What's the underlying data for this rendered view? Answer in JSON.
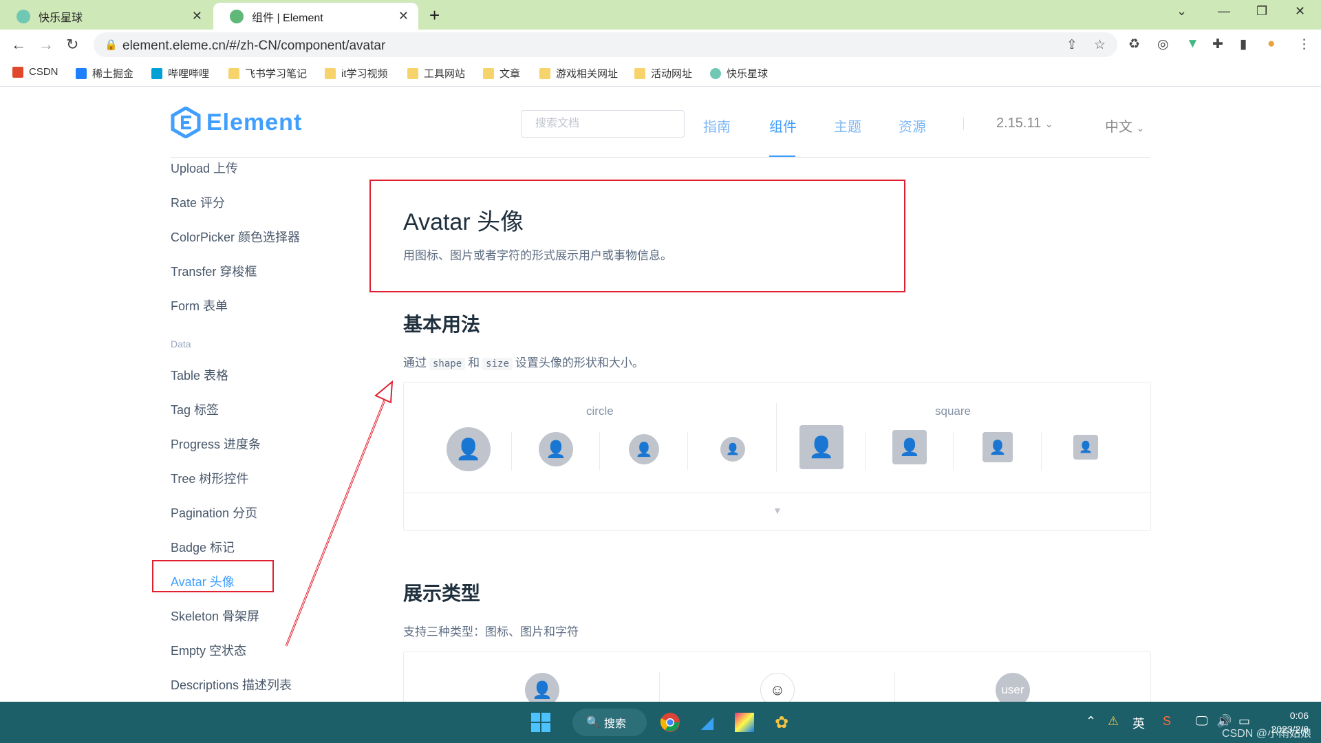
{
  "browser": {
    "tabs": [
      {
        "title": "快乐星球",
        "active": false
      },
      {
        "title": "组件 | Element",
        "active": true
      }
    ],
    "new_tab": "+",
    "url": "element.eleme.cn/#/zh-CN/component/avatar",
    "bookmarks": [
      "CSDN",
      "稀土掘金",
      "哔哩哔哩",
      "飞书学习笔记",
      "it学习视频",
      "工具网站",
      "文章",
      "游戏相关网址",
      "活动网址",
      "快乐星球"
    ]
  },
  "header": {
    "logo_text": "Element",
    "search_placeholder": "搜索文档",
    "nav": [
      "指南",
      "组件",
      "主题",
      "资源"
    ],
    "active_nav": "组件",
    "version": "2.15.11",
    "language": "中文",
    "accent": "#409eff"
  },
  "sidebar": {
    "items_top": [
      "Upload 上传",
      "Rate 评分",
      "ColorPicker 颜色选择器",
      "Transfer 穿梭框",
      "Form 表单"
    ],
    "group": "Data",
    "items_data": [
      "Table 表格",
      "Tag 标签",
      "Progress 进度条",
      "Tree 树形控件",
      "Pagination 分页",
      "Badge 标记",
      "Avatar 头像",
      "Skeleton 骨架屏",
      "Empty 空状态",
      "Descriptions 描述列表"
    ],
    "active": "Avatar 头像"
  },
  "content": {
    "title": "Avatar 头像",
    "description": "用图标、图片或者字符的形式展示用户或事物信息。",
    "section1": {
      "heading": "基本用法",
      "desc_prefix": "通过",
      "code1": "shape",
      "desc_mid": "和",
      "code2": "size",
      "desc_suffix": "设置头像的形状和大小。",
      "label_circle": "circle",
      "label_square": "square"
    },
    "section2": {
      "heading": "展示类型",
      "desc": "支持三种类型：图标、图片和字符",
      "avatar_text": "user"
    }
  },
  "taskbar": {
    "search_label": "搜索",
    "ime": "英",
    "time": "0:06",
    "date": "2023/2/6",
    "watermark": "CSDN @小雨姑娘"
  }
}
